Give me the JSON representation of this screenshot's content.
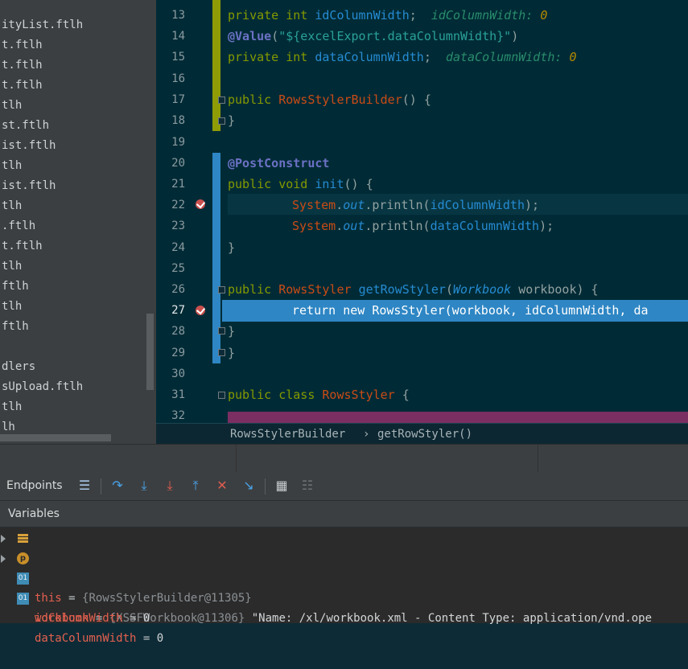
{
  "project_tree": {
    "items": [
      "ityList.ftlh",
      "t.ftlh",
      "t.ftlh",
      "t.ftlh",
      "tlh",
      "st.ftlh",
      "ist.ftlh",
      "tlh",
      "ist.ftlh",
      "tlh",
      ".ftlh",
      "t.ftlh",
      "tlh",
      "ftlh",
      "tlh",
      "ftlh",
      "",
      "dlers",
      "sUpload.ftlh",
      "tlh",
      "lh"
    ]
  },
  "editor": {
    "lines": [
      {
        "num": "13"
      },
      {
        "num": "14"
      },
      {
        "num": "15"
      },
      {
        "num": "16"
      },
      {
        "num": "17"
      },
      {
        "num": "18"
      },
      {
        "num": "19"
      },
      {
        "num": "20"
      },
      {
        "num": "21"
      },
      {
        "num": "22"
      },
      {
        "num": "23"
      },
      {
        "num": "24"
      },
      {
        "num": "25"
      },
      {
        "num": "26"
      },
      {
        "num": "27"
      },
      {
        "num": "28"
      },
      {
        "num": "29"
      },
      {
        "num": "30"
      },
      {
        "num": "31"
      },
      {
        "num": "32"
      }
    ],
    "code": {
      "l13_kw": "private int ",
      "l13_field": "idColumnWidth",
      "l13_semi": ";  ",
      "l13_hint": "idColumnWidth: ",
      "l13_hintval": "0",
      "l14_ann": "@Value",
      "l14_p1": "(",
      "l14_str": "\"${excelExport.dataColumnWidth}\"",
      "l14_p2": ")",
      "l15_kw": "private int ",
      "l15_field": "dataColumnWidth",
      "l15_semi": ";  ",
      "l15_hint": "dataColumnWidth: ",
      "l15_hintval": "0",
      "l17_kw": "public ",
      "l17_name": "RowsStylerBuilder",
      "l17_rest": "() {",
      "l18": "}",
      "l20_ann": "@PostConstruct",
      "l21_kw": "public void ",
      "l21_name": "init",
      "l21_rest": "() {",
      "l22_cls": "System",
      "l22_dot": ".",
      "l22_out": "out",
      "l22_call": ".println(",
      "l22_arg": "idColumnWidth",
      "l22_end": ");",
      "l23_cls": "System",
      "l23_dot": ".",
      "l23_out": "out",
      "l23_call": ".println(",
      "l23_arg": "dataColumnWidth",
      "l23_end": ");",
      "l24": "}",
      "l26_kw": "public ",
      "l26_type": "RowsStyler",
      "l26_sp": " ",
      "l26_name": "getRowStyler",
      "l26_p": "(",
      "l26_ptype": "Workbook",
      "l26_pname": " workbook) {",
      "l27": "return new RowsStyler(workbook, idColumnWidth, da",
      "l28": "}",
      "l29": "}",
      "l31_kw": "public class ",
      "l31_name": "RowsStyler",
      "l31_rest": " {"
    }
  },
  "breadcrumb": {
    "class": "RowsStylerBuilder",
    "sep": "›",
    "method": "getRowStyler()"
  },
  "debugger": {
    "endpoints_label": "Endpoints",
    "toolbar_icons": [
      "menu-icon",
      "step-over-icon",
      "step-into-icon",
      "force-step-into-icon",
      "step-out-icon",
      "drop-frame-icon",
      "run-to-cursor-icon",
      "evaluate-icon",
      "trace-icon"
    ],
    "variables_header": "Variables",
    "variables": [
      {
        "name": "this",
        "eq": " = ",
        "value": "{RowsStylerBuilder@11305}",
        "extra": "",
        "icon": "field-icon"
      },
      {
        "name": "workbook",
        "eq": " = ",
        "value": "{XSSFWorkbook@11306}",
        "extra": " \"Name: /xl/workbook.xml - Content Type: application/vnd.ope",
        "icon": "param-icon"
      },
      {
        "name": "idColumnWidth",
        "eq": " = ",
        "value": "0",
        "extra": "",
        "icon": "int-icon"
      },
      {
        "name": "dataColumnWidth",
        "eq": " = ",
        "value": "0",
        "extra": "",
        "icon": "int-icon"
      }
    ],
    "icon_labels": {
      "param": "p",
      "int": "01"
    }
  },
  "colors": {
    "editor_bg": "#002b36",
    "selection": "#2e86c4",
    "keyword": "#859900",
    "class": "#cb4b16",
    "field": "#268bd2"
  }
}
